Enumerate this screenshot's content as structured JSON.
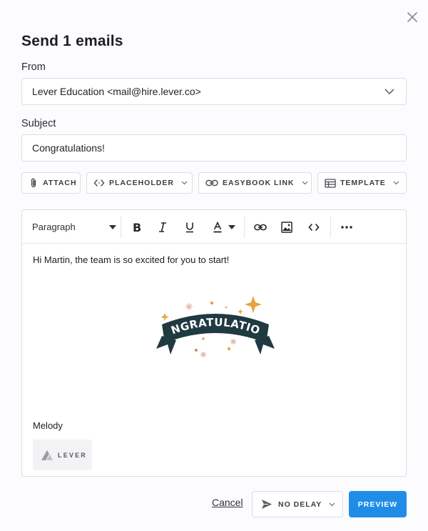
{
  "dialog": {
    "title": "Send 1 emails",
    "close_icon": "close-icon"
  },
  "from": {
    "label": "From",
    "value": "Lever Education <mail@hire.lever.co>"
  },
  "subject": {
    "label": "Subject",
    "value": "Congratulations!"
  },
  "toolbar": {
    "attach_label": "ATTACH",
    "placeholder_label": "PLACEHOLDER",
    "easybook_label": "EASYBOOK LINK",
    "template_label": "TEMPLATE"
  },
  "editor": {
    "paragraph_style": "Paragraph",
    "body_text": "Hi Martin, the team is so excited for you to start!",
    "image_text": "CONGRATULATIONS",
    "signature_name": "Melody",
    "signature_logo_text": "LEVER"
  },
  "footer": {
    "cancel_label": "Cancel",
    "delay_label": "NO DELAY",
    "preview_label": "PREVIEW"
  },
  "colors": {
    "accent": "#1f8de8",
    "banner": "#1f3a40",
    "star": "#e8a23c",
    "background": "#fcfbfd"
  }
}
